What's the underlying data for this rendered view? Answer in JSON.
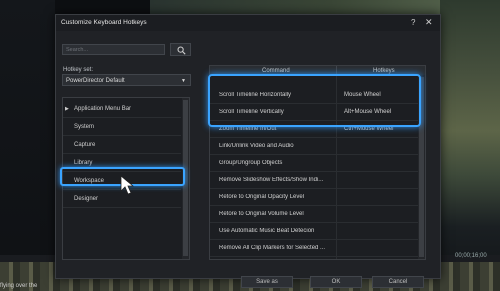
{
  "background": {
    "timecode": "00;00;16;00",
    "caption": "flying over the"
  },
  "dialog": {
    "title": "Customize Keyboard Hotkeys",
    "help_glyph": "?",
    "close_glyph": "✕",
    "search_placeholder": "Search...",
    "hotkey_set_label": "Hotkey set:",
    "hotkey_set_value": "PowerDirector Default",
    "categories": [
      {
        "label": "Application Menu Bar",
        "expandable": true
      },
      {
        "label": "System"
      },
      {
        "label": "Capture"
      },
      {
        "label": "Library"
      },
      {
        "label": "Workspace",
        "selected": true
      },
      {
        "label": "Designer"
      }
    ],
    "table": {
      "col_command": "Command",
      "col_hotkeys": "Hotkeys",
      "rows": [
        {
          "command": "Scroll Timeline Horizontally",
          "hotkey": "Mouse Wheel"
        },
        {
          "command": "Scroll Timeline Vertically",
          "hotkey": "Alt+Mouse Wheel"
        },
        {
          "command": "Zoom Timeline In/Out",
          "hotkey": "Ctrl+Mouse Wheel"
        },
        {
          "command": "Link/Unlink Video and Audio",
          "hotkey": ""
        },
        {
          "command": "Group/Ungroup Objects",
          "hotkey": ""
        },
        {
          "command": "Remove Slideshow Effects/Show Indi...",
          "hotkey": ""
        },
        {
          "command": "Retore to Original Opacity Level",
          "hotkey": ""
        },
        {
          "command": "Retore to Original Volume Level",
          "hotkey": ""
        },
        {
          "command": "Use Automatic Music Beat Detecion",
          "hotkey": ""
        },
        {
          "command": "Remove All Clip Markers for Selected ...",
          "hotkey": ""
        }
      ]
    },
    "buttons": {
      "save_as": "Save as",
      "ok": "OK",
      "cancel": "Cancel"
    },
    "accent_color": "#3aa4ff"
  }
}
